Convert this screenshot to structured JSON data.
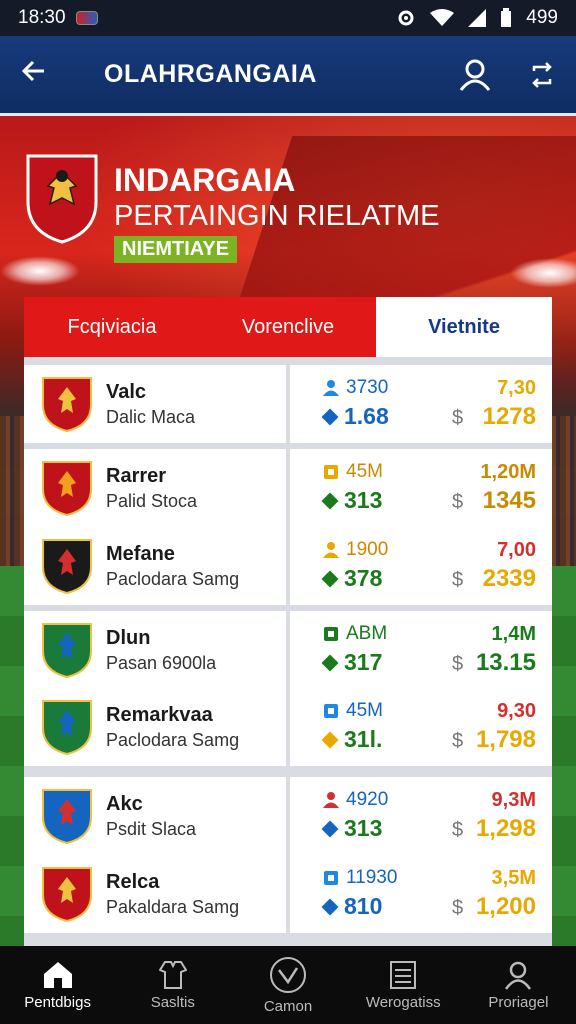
{
  "status_bar": {
    "time": "18:30",
    "battery": "499"
  },
  "app_bar": {
    "title": "OLAHRGANGAIA",
    "back_icon": "arrow-left-icon",
    "actions": [
      "user-icon",
      "refresh-icon"
    ]
  },
  "hero": {
    "title": "INDARGAIA",
    "subtitle": "PERTAINGIN RIELATME",
    "tag": "NIEMTIAYE"
  },
  "tabs": [
    {
      "label": "Fcqiviacia",
      "active": false
    },
    {
      "label": "Vorenclive",
      "active": false
    },
    {
      "label": "Vietnite",
      "active": true
    }
  ],
  "rows": [
    {
      "name": "Valc",
      "sub": "Dalic Maca",
      "stat_top": "3730",
      "stat_bottom": "1.68",
      "val_top": "7,30",
      "val_bottom": "1278",
      "stat_color": "#1565c0",
      "bottom_color": "#1565c0",
      "val_color": "#e8a800",
      "icon": "person-icon",
      "icon_color": "#1e88e5",
      "diamond": "#1565c0"
    },
    {
      "name": "Rarrer",
      "sub": "Palid Stoca",
      "stat_top": "45M",
      "stat_bottom": "313",
      "val_top": "1,20M",
      "val_bottom": "1345",
      "stat_color": "#c88a00",
      "bottom_color": "#1b7a1b",
      "val_color": "#c88a00",
      "icon": "badge-icon",
      "icon_color": "#e8a800",
      "diamond": "#1b7a1b"
    },
    {
      "name": "Mefane",
      "sub": "Paclodara Samg",
      "stat_top": "1900",
      "stat_bottom": "378",
      "val_top": "7,00",
      "val_bottom": "2339",
      "stat_color": "#c88a00",
      "bottom_color": "#1b7a1b",
      "val_color": "#e8a800",
      "icon": "person-icon",
      "icon_color": "#e8a800",
      "diamond": "#1b7a1b",
      "val_top_color": "#d32f2f"
    },
    {
      "name": "Dlun",
      "sub": "Pasan 6900la",
      "stat_top": "ABM",
      "stat_bottom": "317",
      "val_top": "1,4M",
      "val_bottom": "13.15",
      "stat_color": "#1b7a1b",
      "bottom_color": "#1b7a1b",
      "val_color": "#1b7a1b",
      "icon": "badge-icon",
      "icon_color": "#1b7a1b",
      "diamond": "#1b7a1b"
    },
    {
      "name": "Remarkvaa",
      "sub": "Paclodara Samg",
      "stat_top": "45M",
      "stat_bottom": "31l.",
      "val_top": "9,30",
      "val_bottom": "1,798",
      "stat_color": "#1565c0",
      "bottom_color": "#1b7a1b",
      "val_color": "#e8a800",
      "icon": "badge-icon",
      "icon_color": "#1e88e5",
      "diamond": "#e8a800",
      "val_top_color": "#d32f2f"
    },
    {
      "name": "Akc",
      "sub": "Psdit Slaca",
      "stat_top": "4920",
      "stat_bottom": "313",
      "val_top": "9,3M",
      "val_bottom": "1,298",
      "stat_color": "#1565c0",
      "bottom_color": "#1b7a1b",
      "val_color": "#e8a800",
      "icon": "person-icon",
      "icon_color": "#d32f2f",
      "diamond": "#1565c0",
      "val_top_color": "#d32f2f"
    },
    {
      "name": "Relca",
      "sub": "Pakaldara Samg",
      "stat_top": "11930",
      "stat_bottom": "810",
      "val_top": "3,5M",
      "val_bottom": "1,200",
      "stat_color": "#1565c0",
      "bottom_color": "#1565c0",
      "val_color": "#e8a800",
      "icon": "badge-icon",
      "icon_color": "#1e88e5",
      "diamond": "#1565c0"
    }
  ],
  "currency_symbol": "$",
  "bottom_nav": [
    {
      "label": "Pentdbigs",
      "icon": "home-icon",
      "active": true
    },
    {
      "label": "Sasltis",
      "icon": "shirt-icon",
      "active": false
    },
    {
      "label": "Camon",
      "icon": "ball-icon",
      "active": false
    },
    {
      "label": "Werogatiss",
      "icon": "list-icon",
      "active": false
    },
    {
      "label": "Proriagel",
      "icon": "profile-icon",
      "active": false
    }
  ]
}
